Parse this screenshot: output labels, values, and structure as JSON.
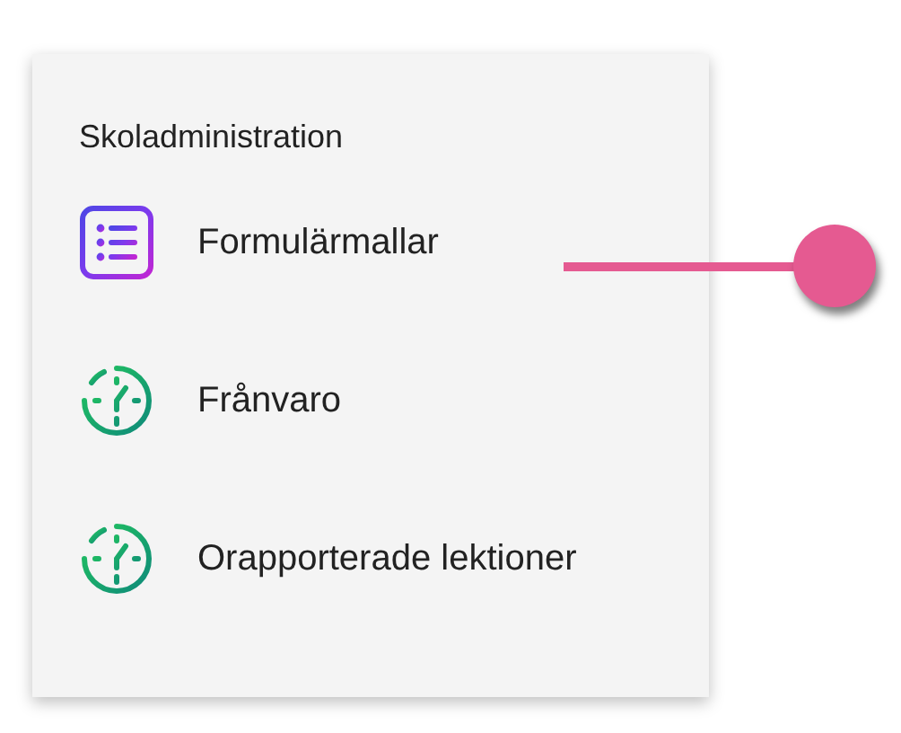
{
  "menu": {
    "heading": "Skoladministration",
    "items": [
      {
        "label": "Formulärmallar",
        "kind": "list"
      },
      {
        "label": "Frånvaro",
        "kind": "clock"
      },
      {
        "label": "Orapporterade lektioner",
        "kind": "clock"
      }
    ]
  }
}
